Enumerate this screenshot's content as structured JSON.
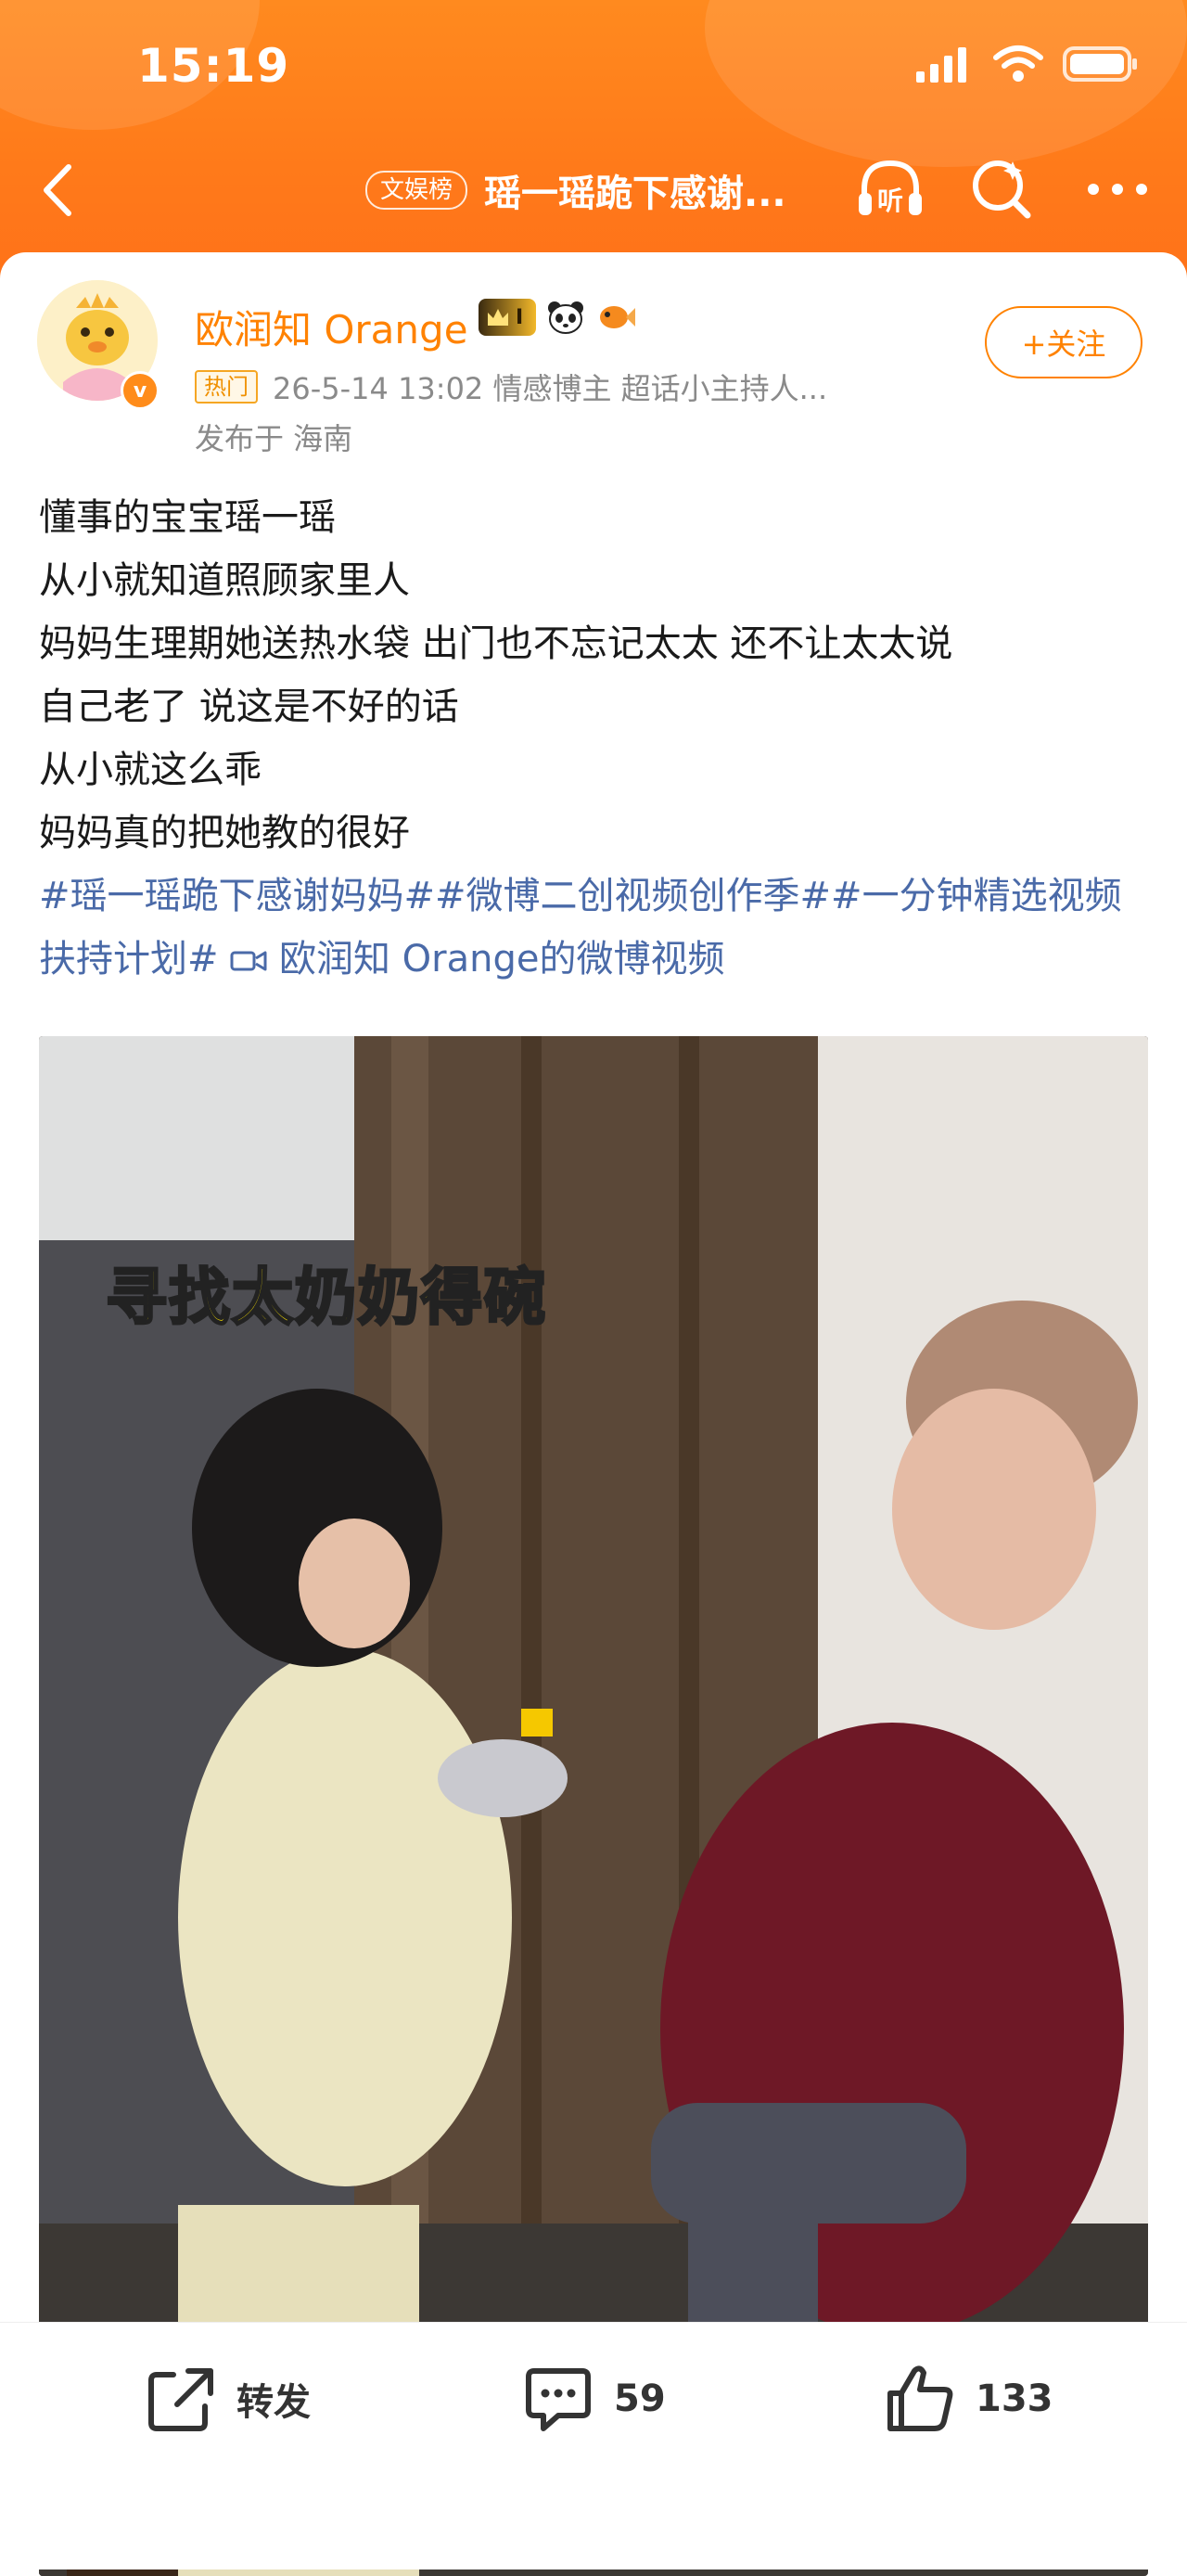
{
  "status_bar": {
    "time": "15:19"
  },
  "nav": {
    "rank_tag": "文娱榜",
    "title": "瑶一瑶跪下感谢...",
    "listen_label": "听"
  },
  "post": {
    "author": "欧润知 Orange",
    "vip_level": "I",
    "hot_tag": "热门",
    "meta": "26-5-14 13:02  情感博主 超话小主持人...",
    "location": "发布于 海南",
    "follow_label": "+关注",
    "lines": [
      "懂事的宝宝瑶一瑶",
      "从小就知道照顾家里人",
      "妈妈生理期她送热水袋 出门也不忘记太太 还不让太太说",
      "自己老了 说这是不好的话",
      "从小就这么乖",
      "妈妈真的把她教的很好"
    ],
    "hashtags": "#瑶一瑶跪下感谢妈妈##微博二创视频创作季##一分钟精选视频扶持计划#",
    "video_link": "欧润知 Orange的微博视频"
  },
  "video": {
    "caption": "寻找太奶奶得碗"
  },
  "actions": {
    "repost_label": "转发",
    "comment_count": "59",
    "like_count": "133"
  },
  "colors": {
    "header_orange": "#ff7a1a",
    "username_orange": "#ff8200",
    "link_blue": "#4a6aa8"
  },
  "icons": [
    "back-icon",
    "listen-icon",
    "search-icon",
    "more-icon",
    "repost-icon",
    "comment-icon",
    "like-icon"
  ]
}
